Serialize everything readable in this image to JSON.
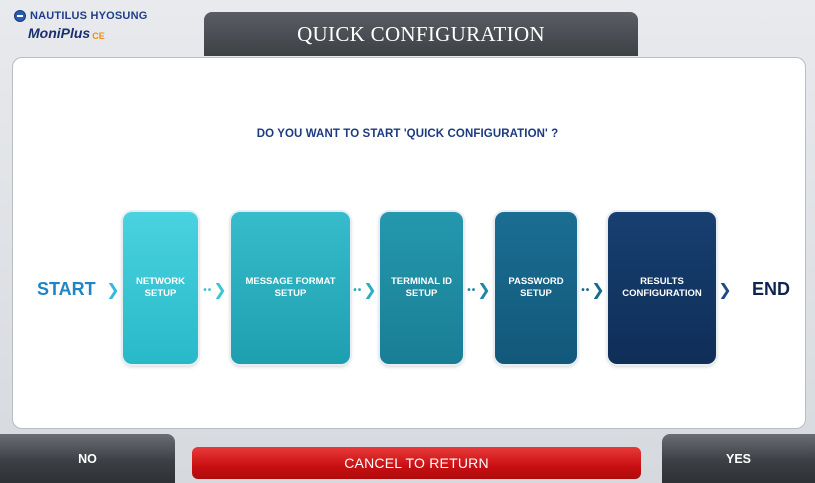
{
  "header": {
    "brand": "NAUTILUS HYOSUNG",
    "product": "MoniPlus",
    "product_version": "CE",
    "title": "QUICK CONFIGURATION"
  },
  "main": {
    "question": "DO YOU WANT TO START 'QUICK CONFIGURATION' ?",
    "start_label": "START",
    "end_label": "END",
    "steps": [
      {
        "line1": "NETWORK",
        "line2": "SETUP"
      },
      {
        "line1": "MESSAGE FORMAT",
        "line2": "SETUP"
      },
      {
        "line1": "TERMINAL ID",
        "line2": "SETUP"
      },
      {
        "line1": "PASSWORD",
        "line2": "SETUP"
      },
      {
        "line1": "RESULTS",
        "line2": "CONFIGURATION"
      }
    ]
  },
  "footer": {
    "no_label": "NO",
    "cancel_label": "CANCEL TO RETURN",
    "yes_label": "YES"
  },
  "colors": {
    "title_bar": "#4a4d52",
    "cancel": "#d01418",
    "step1": "#33c4d3",
    "step5": "#132f5c",
    "text_blue": "#1d3a80"
  },
  "icons": {
    "brand": "hyosung-logo-icon",
    "connector": "double-chevron-right-icon"
  }
}
